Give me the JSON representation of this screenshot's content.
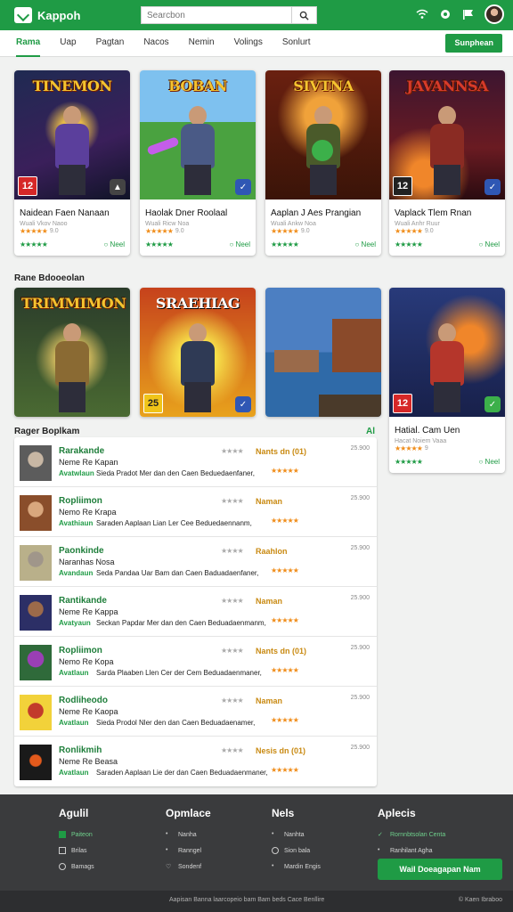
{
  "app": {
    "logo": "Kappoh"
  },
  "search": {
    "placeholder": "Searcbon"
  },
  "nav": {
    "tabs": [
      {
        "label": "Rama",
        "active": true
      },
      {
        "label": "Uap"
      },
      {
        "label": "Pagtan"
      },
      {
        "label": "Nacos"
      },
      {
        "label": "Nemin"
      },
      {
        "label": "Volings"
      },
      {
        "label": "Sonlurt"
      }
    ],
    "cta": "Sunphean"
  },
  "featured": [
    {
      "art_title": "TINEMON",
      "title": "Naidean Faen Nanaan",
      "sub": "Wuali Vkov Naoo",
      "stars": "★★★★★",
      "rating": "9.0",
      "rating_badge": "12",
      "link": "Neel",
      "colors": {
        "bg": "#2b3a6b",
        "accent": "#6a4fb3"
      }
    },
    {
      "art_title": "BOBAN",
      "title": "Haolak Dner Roolaal",
      "sub": "Wuali Ricw Noa",
      "stars": "★★★★★",
      "rating": "9.0",
      "rating_badge": "",
      "link": "Neel",
      "colors": {
        "bg": "#3b8a3a",
        "accent": "#4a5a86"
      }
    },
    {
      "art_title": "SIVTNA",
      "title": "Aaplan J Aes Prangian",
      "sub": "Wuali Ankw Noa",
      "stars": "★★★★★",
      "rating": "9.0",
      "rating_badge": "",
      "link": "Neel",
      "colors": {
        "bg": "#8a3a12",
        "accent": "#4a5a2a"
      }
    },
    {
      "art_title": "JAVANNSA",
      "title": "Vaplack Tlem Rnan",
      "sub": "Wuali Anhr Ruur",
      "stars": "★★★★★",
      "rating": "9.0",
      "rating_badge": "12",
      "link": "Neel",
      "colors": {
        "bg": "#5a1f2b",
        "accent": "#8a2b23"
      }
    }
  ],
  "section_popular": {
    "title": "Rane Bdooeolan"
  },
  "popular": [
    {
      "art_title": "TRIMMIMON",
      "rating_badge": "",
      "colors": {
        "bg": "#314b2f",
        "accent": "#8a6a33"
      }
    },
    {
      "art_title": "SRAEHIAG",
      "rating_badge": "25",
      "colors": {
        "bg": "#c6421c",
        "accent": "#2f3a55"
      }
    },
    {
      "art_title": "",
      "rating_badge": "",
      "colors": {
        "bg": "#4c7fc2",
        "accent": "#8a4a2a"
      }
    },
    {
      "art_title": "",
      "rating_badge": "12",
      "title": "Hatial. Cam Uen",
      "sub": "Hacat Noiem Vaaa",
      "stars": "★★★★★",
      "rating": "9",
      "link": "Neel",
      "colors": {
        "bg": "#283a7a",
        "accent": "#b5362b"
      }
    }
  ],
  "section_list": {
    "title": "Rager Boplkam",
    "more": "Al"
  },
  "list": [
    {
      "name": "Rarakande",
      "sub": "Neme Re Kapan",
      "tag": "Avatwlaun",
      "desc": "Sieda Pradot Mer dan den Caen Beduedaenfaner,",
      "gstars": "★★★★",
      "label": "Nants dn (01)",
      "stars": "★★★★★",
      "score": "25.900",
      "thumb": {
        "bg": "#5c5c5c",
        "skin": "#c8b7a4"
      }
    },
    {
      "name": "Ropliimon",
      "sub": "Nemo Re Krapa",
      "tag": "Avathiaun",
      "desc": "Saraden Aaplaan Lian Ler Cee Beduedaennanm,",
      "gstars": "★★★★",
      "label": "Naman",
      "stars": "★★★★★",
      "score": "25.900",
      "thumb": {
        "bg": "#8a4e2b",
        "skin": "#d9a77d"
      }
    },
    {
      "name": "Paonkinde",
      "sub": "Naranhas Nosa",
      "tag": "Avandaun",
      "desc": "Seda Pandaa Uar Bam dan Caen Baduadaenfaner,",
      "gstars": "★★★★",
      "label": "Raahlon",
      "stars": "★★★★★",
      "score": "25.900",
      "thumb": {
        "bg": "#b9b08a",
        "skin": "#a0968a"
      }
    },
    {
      "name": "Rantikande",
      "sub": "Neme Re Kappa",
      "tag": "Avatyaun",
      "desc": "Seckan Papdar Mer dan den Caen Beduadaenmanm,",
      "gstars": "★★★★",
      "label": "Naman",
      "stars": "★★★★★",
      "score": "25.900",
      "thumb": {
        "bg": "#2c2f66",
        "skin": "#9c6a4a"
      }
    },
    {
      "name": "Ropliimon",
      "sub": "Nemo Re Kopa",
      "tag": "Avatlaun",
      "desc": "Sarda Plaaben Llen Cer der Cem Beduadaenmaner,",
      "gstars": "★★★★",
      "label": "Nants dn (01)",
      "stars": "★★★★★",
      "score": "25.900",
      "thumb": {
        "bg": "#2f6a3a",
        "skin": "#9a3fb5"
      }
    },
    {
      "name": "Rodliheodo",
      "sub": "Neme Re Kaopa",
      "tag": "Avatlaun",
      "desc": "Sieda Prodol Nler den dan Caen Beduadaenamer,",
      "gstars": "★★★★",
      "label": "Naman",
      "stars": "★★★★★",
      "score": "25.900",
      "thumb": {
        "bg": "#f2d23a",
        "skin": "#c23b2b"
      }
    },
    {
      "name": "Ronlikmih",
      "sub": "Neme Re Beasa",
      "tag": "Avatlaun",
      "desc": "Saraden Aaplaan Lie der dan Caen Beduadaenmaner,",
      "gstars": "★★★★",
      "label": "Nesis dn (01)",
      "stars": "★★★★★",
      "score": "25.900",
      "thumb": {
        "bg": "#1a1a1a",
        "skin": "#e35a1c"
      }
    }
  ],
  "footer": {
    "cols": [
      {
        "title": "Agulil",
        "links": [
          "Paiteon",
          "Brilas",
          "Bamags"
        ]
      },
      {
        "title": "Opmlace",
        "links": [
          "Nanha",
          "Ranngel",
          "Sondenf"
        ]
      },
      {
        "title": "Nels",
        "links": [
          "Nanhta",
          "Sion bala",
          "Mardin Engis"
        ]
      },
      {
        "title": "Aplecis",
        "links": [
          "Rornnbtsolan Centa",
          "Ranhilant Agha"
        ]
      }
    ],
    "cta": "Wail Doeagapan Nam",
    "copyright": "Aapisan Banna laarcopeio bam Bam beds Cace Benllire",
    "brand": "Kaen Ibraboo"
  }
}
